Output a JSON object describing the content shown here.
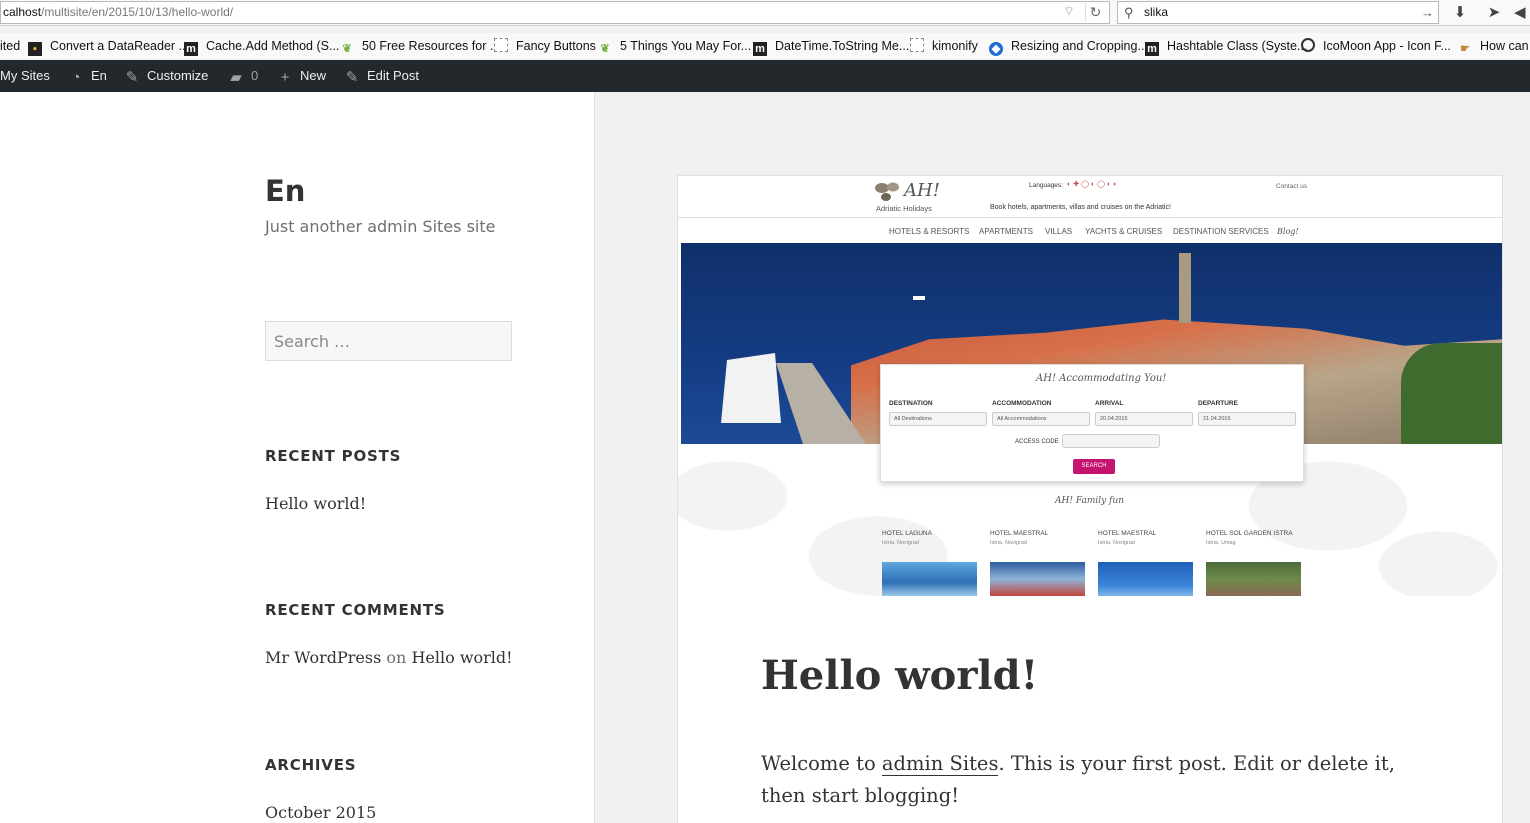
{
  "browser": {
    "url_host": "calhost",
    "url_path": "/multisite/en/2015/10/13/hello-world/",
    "search_value": "slika"
  },
  "bookmarks": [
    {
      "label": "ited",
      "icon": "tab-fragment"
    },
    {
      "label": "Convert a DataReader ...",
      "icon": "dark-icon"
    },
    {
      "label": "Cache.Add Method (S...",
      "icon": "m-icon"
    },
    {
      "label": "50 Free Resources for ...",
      "icon": "leaf-icon"
    },
    {
      "label": "Fancy Buttons",
      "icon": "blank-page-icon"
    },
    {
      "label": "5 Things You May For...",
      "icon": "leaf-icon"
    },
    {
      "label": "DateTime.ToString Me...",
      "icon": "m-icon"
    },
    {
      "label": "kimonify",
      "icon": "blank-page-icon"
    },
    {
      "label": "Resizing and Cropping...",
      "icon": "blue-drop-icon"
    },
    {
      "label": "Hashtable Class (Syste...",
      "icon": "m-icon"
    },
    {
      "label": "IcoMoon App - Icon F...",
      "icon": "circle-icon"
    },
    {
      "label": "How can",
      "icon": "hand-icon"
    }
  ],
  "adminbar": {
    "my_sites": "My Sites",
    "site": "En",
    "customize": "Customize",
    "comments_count": "0",
    "new": "New",
    "edit_post": "Edit Post"
  },
  "sidebar": {
    "site_title": "En",
    "site_description": "Just another admin Sites site",
    "search_placeholder": "Search …",
    "recent_posts_title": "RECENT POSTS",
    "recent_posts": [
      "Hello world!"
    ],
    "recent_comments_title": "RECENT COMMENTS",
    "comment_author": "Mr WordPress",
    "comment_on": "on",
    "comment_post": "Hello world!",
    "archives_title": "ARCHIVES",
    "archives": [
      "October 2015"
    ]
  },
  "featured": {
    "logo": "AH!",
    "logo_sub": "Adriatic Holidays",
    "languages_label": "Languages:",
    "contact": "Contact us",
    "tagline": "Book hotels, apartments, villas and cruises on the Adriatic!",
    "nav": [
      "HOTELS & RESORTS",
      "APARTMENTS",
      "VILLAS",
      "YACHTS & CRUISES",
      "DESTINATION SERVICES",
      "Blog!"
    ],
    "widget_title": "AH! Accommodating You!",
    "destination_label": "DESTINATION",
    "destination_value": "All Destinations",
    "accommodation_label": "ACCOMMODATION",
    "accommodation_value": "All Accommodations",
    "arrival_label": "ARRIVAL",
    "arrival_value": "20.04.2015",
    "departure_label": "DEPARTURE",
    "departure_value": "21.04.2015",
    "access_label": "ACCESS CODE",
    "search_button": "SEARCH",
    "family_fun": "AH! Family fun",
    "hotels": [
      {
        "name": "HOTEL LAGUNA",
        "loc": "Istria, Novigrad"
      },
      {
        "name": "HOTEL MAESTRAL",
        "loc": "Istria, Novigrad"
      },
      {
        "name": "HOTEL MAESTRAL",
        "loc": "Istria, Novigrad"
      },
      {
        "name": "HOTEL SOL GARDEN ISTRA",
        "loc": "Istria, Umag"
      }
    ]
  },
  "post": {
    "title": "Hello world!",
    "body_prefix": "Welcome to ",
    "body_link": "admin Sites",
    "body_suffix": ". This is your first post. Edit or delete it, then start blogging!"
  }
}
